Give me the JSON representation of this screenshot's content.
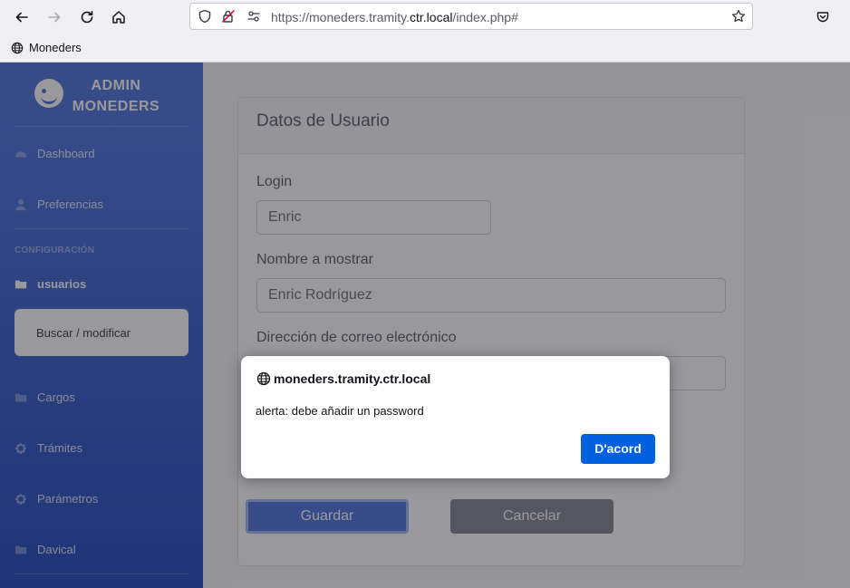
{
  "browser": {
    "url_prefix": "https://moneders.tramity.",
    "url_host": "ctr.local",
    "url_suffix": "/index.php#",
    "bookmark_label": "Moneders"
  },
  "sidebar": {
    "brand_line1": "ADMIN",
    "brand_line2": "MONEDERS",
    "heading": "CONFIGURACIÓN",
    "items": [
      {
        "label": "Dashboard",
        "icon": "tachometer-icon"
      },
      {
        "label": "Preferencias",
        "icon": "user-icon"
      },
      {
        "label": "usuarios",
        "icon": "folder-icon"
      },
      {
        "label": "Cargos",
        "icon": "folder-icon"
      },
      {
        "label": "Trámites",
        "icon": "cog-icon"
      },
      {
        "label": "Parámetros",
        "icon": "cog-icon"
      },
      {
        "label": "Davical",
        "icon": "folder-icon"
      }
    ],
    "submenu_item": "Buscar / modificar"
  },
  "form": {
    "title": "Datos de Usuario",
    "login_label": "Login",
    "login_value": "Enric",
    "display_name_label": "Nombre a mostrar",
    "display_name_value": "Enric Rodríguez",
    "email_label": "Dirección de correo electrónico",
    "save_label": "Guardar",
    "cancel_label": "Cancelar"
  },
  "dialog": {
    "host": "moneders.tramity.ctr.local",
    "message": "alerta: debe añadir un password",
    "ok_label": "D'acord"
  },
  "colors": {
    "sidebar_top": "#4e73df",
    "sidebar_bottom": "#224abe",
    "primary": "#4e73df",
    "secondary": "#858796",
    "dialog_button": "#0061e0"
  }
}
